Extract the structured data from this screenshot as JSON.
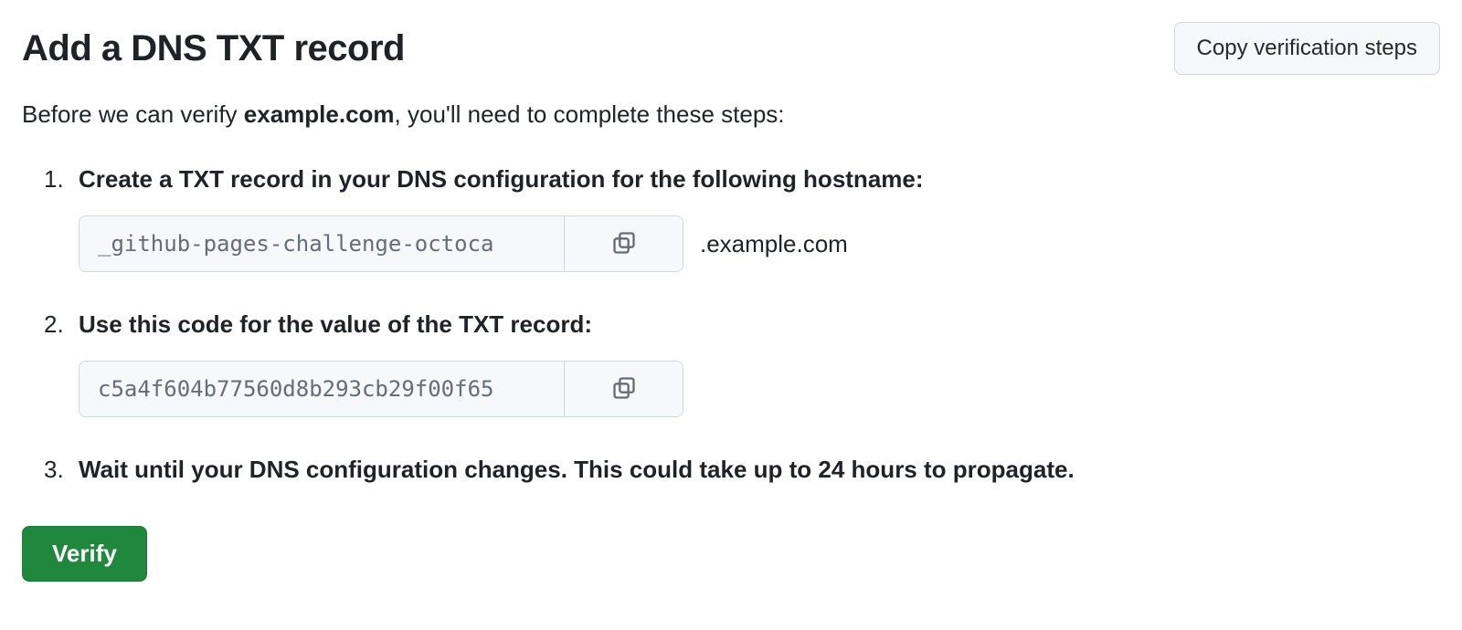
{
  "header": {
    "title": "Add a DNS TXT record",
    "copy_steps_label": "Copy verification steps"
  },
  "intro": {
    "prefix": "Before we can verify ",
    "domain": "example.com",
    "suffix": ", you'll need to complete these steps:"
  },
  "steps": {
    "step1": {
      "title": "Create a TXT record in your DNS configuration for the following hostname:",
      "hostname_value": "_github-pages-challenge-octoca",
      "domain_suffix": ".example.com"
    },
    "step2": {
      "title": "Use this code for the value of the TXT record:",
      "code_value": "c5a4f604b77560d8b293cb29f00f65"
    },
    "step3": {
      "title": "Wait until your DNS configuration changes. This could take up to 24 hours to propagate."
    }
  },
  "actions": {
    "verify_label": "Verify"
  }
}
